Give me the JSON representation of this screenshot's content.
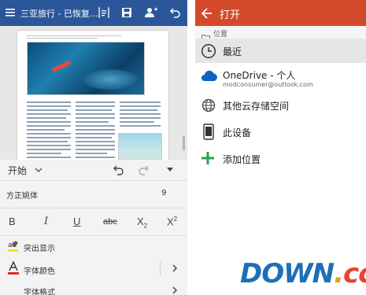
{
  "word": {
    "title": "三亚旅行 - 已恢复...",
    "ribbon": {
      "tab_label": "开始",
      "font_name": "方正姚体",
      "font_size": "9",
      "format_buttons": {
        "bold": "B",
        "italic": "I",
        "underline": "U",
        "strike": "abc",
        "subscript_base": "X",
        "subscript_mark": "2",
        "superscript_base": "X",
        "superscript_mark": "2"
      },
      "highlight_label": "突出显示",
      "font_color_label": "字体颜色",
      "font_style_label": "字体格式"
    }
  },
  "open_panel": {
    "title": "打开",
    "section_label": "位置",
    "locations": {
      "recent": "最近",
      "onedrive": "OneDrive - 个人",
      "onedrive_account": "modconsumer@outlook.com",
      "other_cloud": "其他云存储空间",
      "this_device": "此设备",
      "add_place": "添加位置"
    }
  },
  "watermark": {
    "main": "DOWN",
    "dot": ".",
    "tld": "cc"
  },
  "colors": {
    "word_blue": "#2b579a",
    "open_header_orange": "#d34a2b",
    "onedrive_blue": "#0f62c4",
    "add_green": "#2e9e4f",
    "font_color_red": "#d92b2b"
  },
  "icons": {
    "menu": "hamburger-icon",
    "read_mode": "read-mode-icon",
    "save": "save-icon",
    "share": "share-person-icon",
    "undo": "undo-icon",
    "redo": "redo-icon",
    "back": "back-arrow-icon",
    "recent": "clock-icon",
    "onedrive": "cloud-icon",
    "other_cloud": "globe-icon",
    "device": "phone-icon",
    "add": "plus-icon"
  }
}
